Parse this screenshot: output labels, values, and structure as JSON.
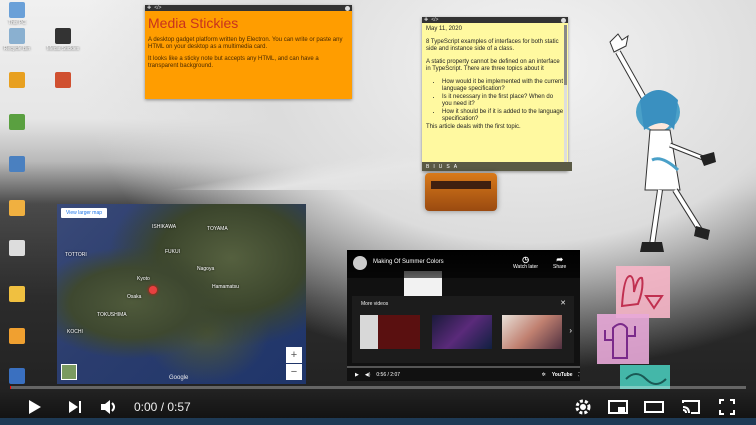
{
  "desktop_icons": [
    {
      "label": "This PC",
      "color": "#6aa0d8"
    },
    {
      "label": "Recycle Bin",
      "color": "#8ab0d0"
    },
    {
      "label": "Media Stickies",
      "color": "#333333"
    },
    {
      "label": "",
      "color": "#e8a020"
    },
    {
      "label": "",
      "color": "#d05030"
    },
    {
      "label": "",
      "color": "#5aa040"
    },
    {
      "label": "",
      "color": "#4a80c0"
    },
    {
      "label": "",
      "color": "#f0b040"
    },
    {
      "label": "",
      "color": "#dddddd"
    },
    {
      "label": "",
      "color": "#f0c040"
    },
    {
      "label": "",
      "color": "#f0a030"
    },
    {
      "label": "",
      "color": "#3a70c0"
    }
  ],
  "orange_sticky": {
    "title": "Media Stickies",
    "p1": "A desktop gadget platform written by Electron. You can write or paste any HTML on your desktop as a multimedia card.",
    "p2": "It looks like a sticky note but accepts any HTML, and can have a transparent background."
  },
  "yellow_sticky": {
    "date": "May 11, 2020",
    "p1": "8 TypeScript examples of interfaces for both static side and instance side of a class.",
    "p2": "A static property cannot be defined on an interface in TypeScript. There are three topics about it",
    "bullets": [
      "How would it be implemented with the current language specification?",
      "Is it necessary in the first place? When do you need it?",
      "How it should be if it is added to the language specification?"
    ],
    "p3": "This article deals with the first topic.",
    "toolbar": [
      "B",
      "I",
      "U",
      "S",
      "A"
    ]
  },
  "map": {
    "view_larger": "View larger map",
    "cities": [
      "ISHIKAWA",
      "TOYAMA",
      "FUKUI",
      "TOTTORI",
      "Kyoto",
      "Nagoya",
      "Osaka",
      "Hamamatsu",
      "TOKUSHIMA",
      "KOCHI"
    ],
    "zoom_in": "+",
    "zoom_out": "−",
    "google": "Google"
  },
  "youtube": {
    "title": "Making Of Summer Colors",
    "watch_later": "Watch later",
    "share": "Share",
    "more_videos": "More videos",
    "time": "0:56 / 2:07",
    "logo": "YouTube"
  },
  "player": {
    "time": "0:00 / 0:57",
    "progress_fraction": 0.0
  }
}
